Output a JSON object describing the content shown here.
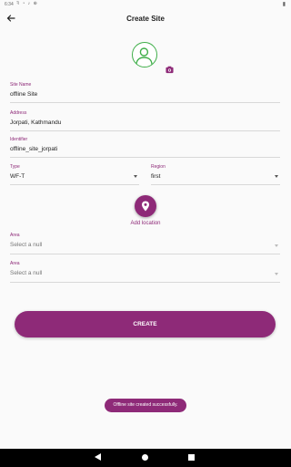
{
  "status_bar": {
    "time": "6:34",
    "icons": "ꟻ ◔ ♪ ⊕",
    "right_icon": "battery-icon"
  },
  "app_bar": {
    "title": "Create Site",
    "back_icon": "arrow-back-icon"
  },
  "avatar": {
    "icon": "person-icon",
    "accent": "#3fae49"
  },
  "camera": {
    "icon": "camera-icon"
  },
  "form": {
    "site_name": {
      "label": "Site Name",
      "value": "offline Site"
    },
    "address": {
      "label": "Address",
      "value": "Jorpati, Kathmandu"
    },
    "identifier": {
      "label": "Identifier",
      "value": "offline_site_jorpati"
    },
    "type": {
      "label": "Type",
      "value": "WF-T"
    },
    "region": {
      "label": "Region",
      "value": "first"
    },
    "area1": {
      "label": "Area",
      "placeholder": "Select a null"
    },
    "area2": {
      "label": "Area",
      "placeholder": "Select a null"
    }
  },
  "location": {
    "label": "Add location",
    "icon": "location-pin-icon"
  },
  "create_button": {
    "label": "CREATE"
  },
  "toast": {
    "text": "Offline site created successfully."
  },
  "colors": {
    "primary": "#8e2a78",
    "avatar_ring": "#3fae49",
    "nav": "#000000"
  }
}
